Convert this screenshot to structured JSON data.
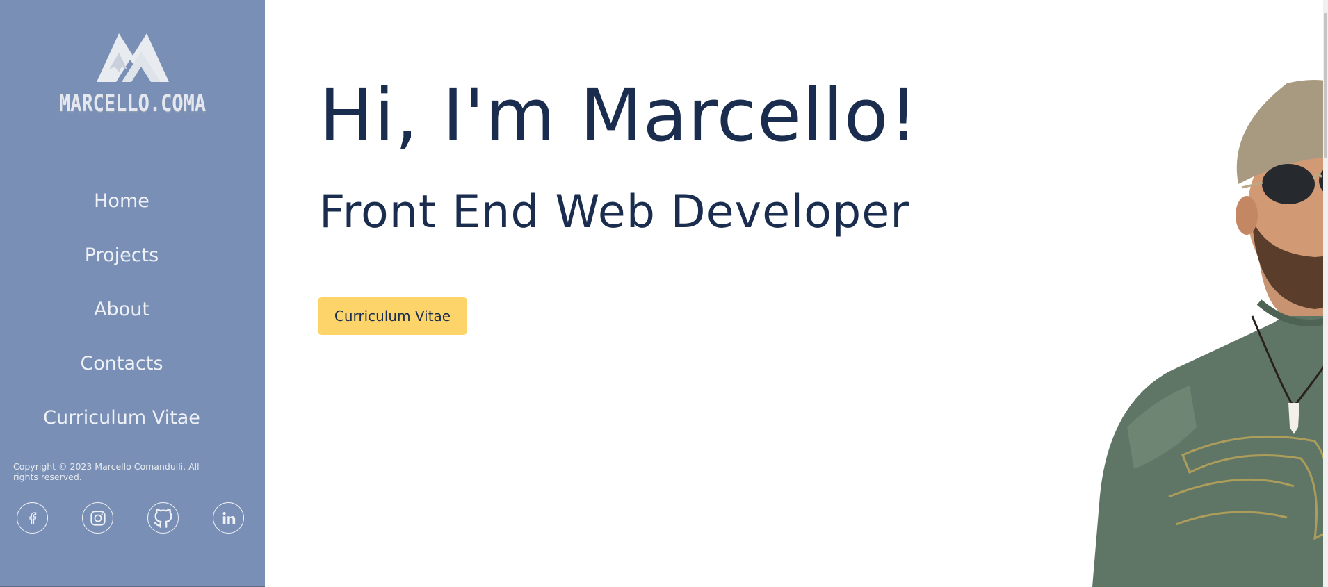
{
  "brand": {
    "logo_icon": "mc-mountain-logo",
    "name": "MARCELLO.COMA"
  },
  "nav": {
    "items": [
      {
        "label": "Home"
      },
      {
        "label": "Projects"
      },
      {
        "label": "About"
      },
      {
        "label": "Contacts"
      },
      {
        "label": "Curriculum Vitae"
      }
    ]
  },
  "footer": {
    "copyright": "Copyright © 2023 Marcello Comandulli. All rights reserved.",
    "socials": [
      {
        "icon": "facebook-icon"
      },
      {
        "icon": "instagram-icon"
      },
      {
        "icon": "github-icon"
      },
      {
        "icon": "linkedin-icon"
      }
    ]
  },
  "hero": {
    "title": "Hi, I'm Marcello!",
    "subtitle": "Front End Web Developer",
    "cta_label": "Curriculum Vitae"
  },
  "colors": {
    "sidebar_bg": "#7a8fb5",
    "heading": "#1a2d4f",
    "cta_bg": "#fdd46a"
  }
}
